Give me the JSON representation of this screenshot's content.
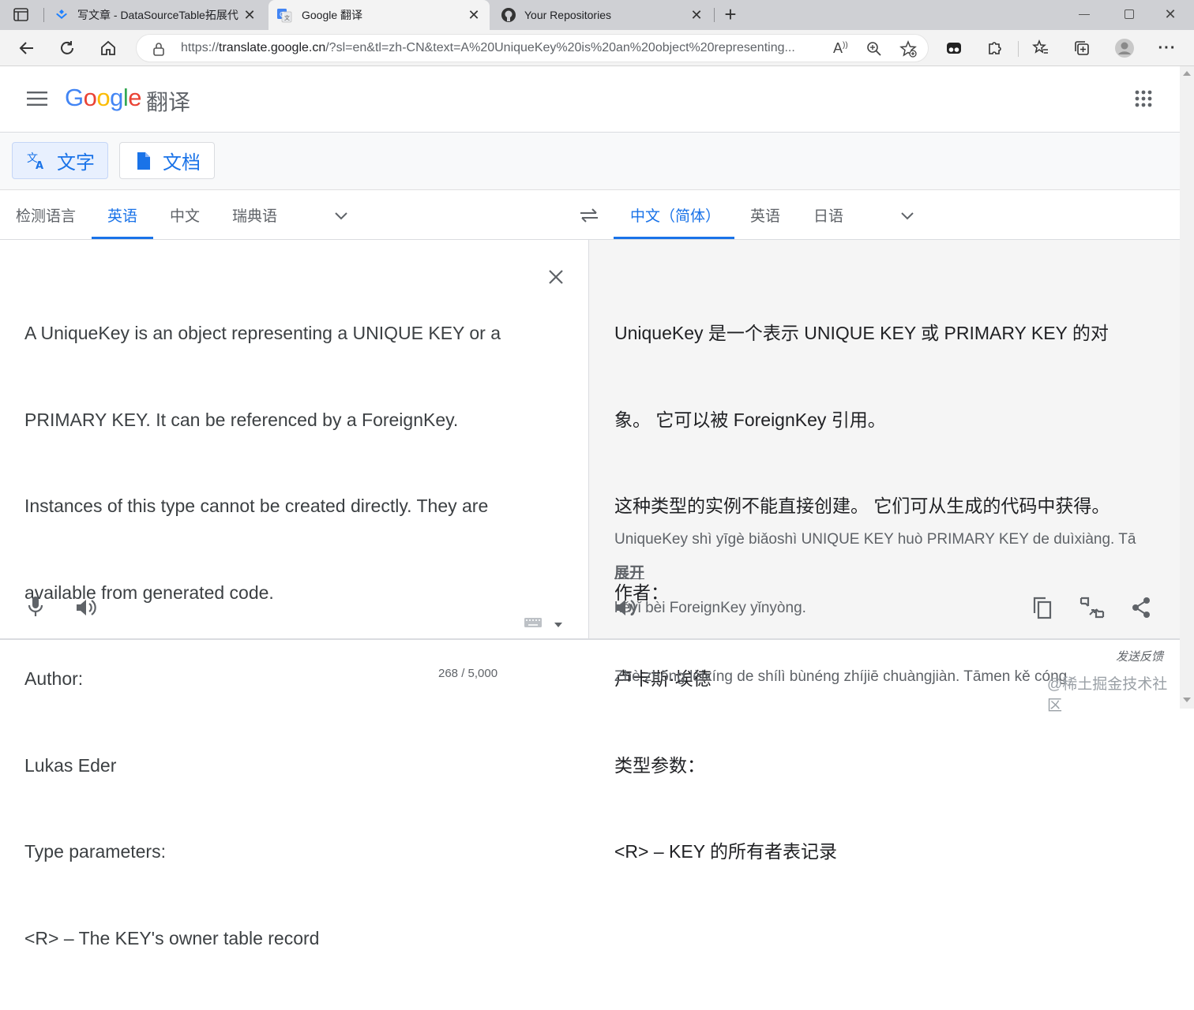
{
  "browser": {
    "tabs": [
      {
        "title": "写文章 - DataSourceTable拓展代",
        "active": false
      },
      {
        "title": "Google 翻译",
        "active": true
      },
      {
        "title": "Your Repositories",
        "active": false
      }
    ],
    "url_prefix": "https://",
    "url_host": "translate.google.cn",
    "url_rest": "/?sl=en&tl=zh-CN&text=A%20UniqueKey%20is%20an%20object%20representing..."
  },
  "header": {
    "logo_text": "Google",
    "product_name": "翻译"
  },
  "modes": {
    "text_label": "文字",
    "docs_label": "文档"
  },
  "source_langs": [
    "检测语言",
    "英语",
    "中文",
    "瑞典语"
  ],
  "target_langs": [
    "中文（简体）",
    "英语",
    "日语"
  ],
  "source": {
    "lines": [
      "A UniqueKey is an object representing a UNIQUE KEY or a",
      "PRIMARY KEY. It can be referenced by a ForeignKey.",
      "Instances of this type cannot be created directly. They are",
      "available from generated code.",
      "Author:",
      "Lukas Eder",
      "Type parameters:",
      "<R> – The KEY's owner table record"
    ],
    "char_count": "268 / 5,000"
  },
  "target": {
    "lines": [
      "UniqueKey 是一个表示 UNIQUE KEY 或 PRIMARY KEY 的对",
      "象。 它可以被 ForeignKey 引用。",
      "这种类型的实例不能直接创建。 它们可从生成的代码中获得。",
      "作者：",
      "卢卡斯·埃德",
      "类型参数：",
      "<R> – KEY 的所有者表记录"
    ],
    "romanization": [
      "UniqueKey shì yīgè biǎoshì UNIQUE KEY huò PRIMARY KEY de duìxiàng. Tā",
      "kěyǐ bèi ForeignKey yǐnyòng.",
      "Zhè zhǒng lèixíng de shílì bùnéng zhíjiē chuàngjiàn. Tāmen kě cóng"
    ],
    "expand_label": "展开"
  },
  "footer": {
    "feedback": "发送反馈",
    "watermark": "@稀土掘金技术社区"
  }
}
